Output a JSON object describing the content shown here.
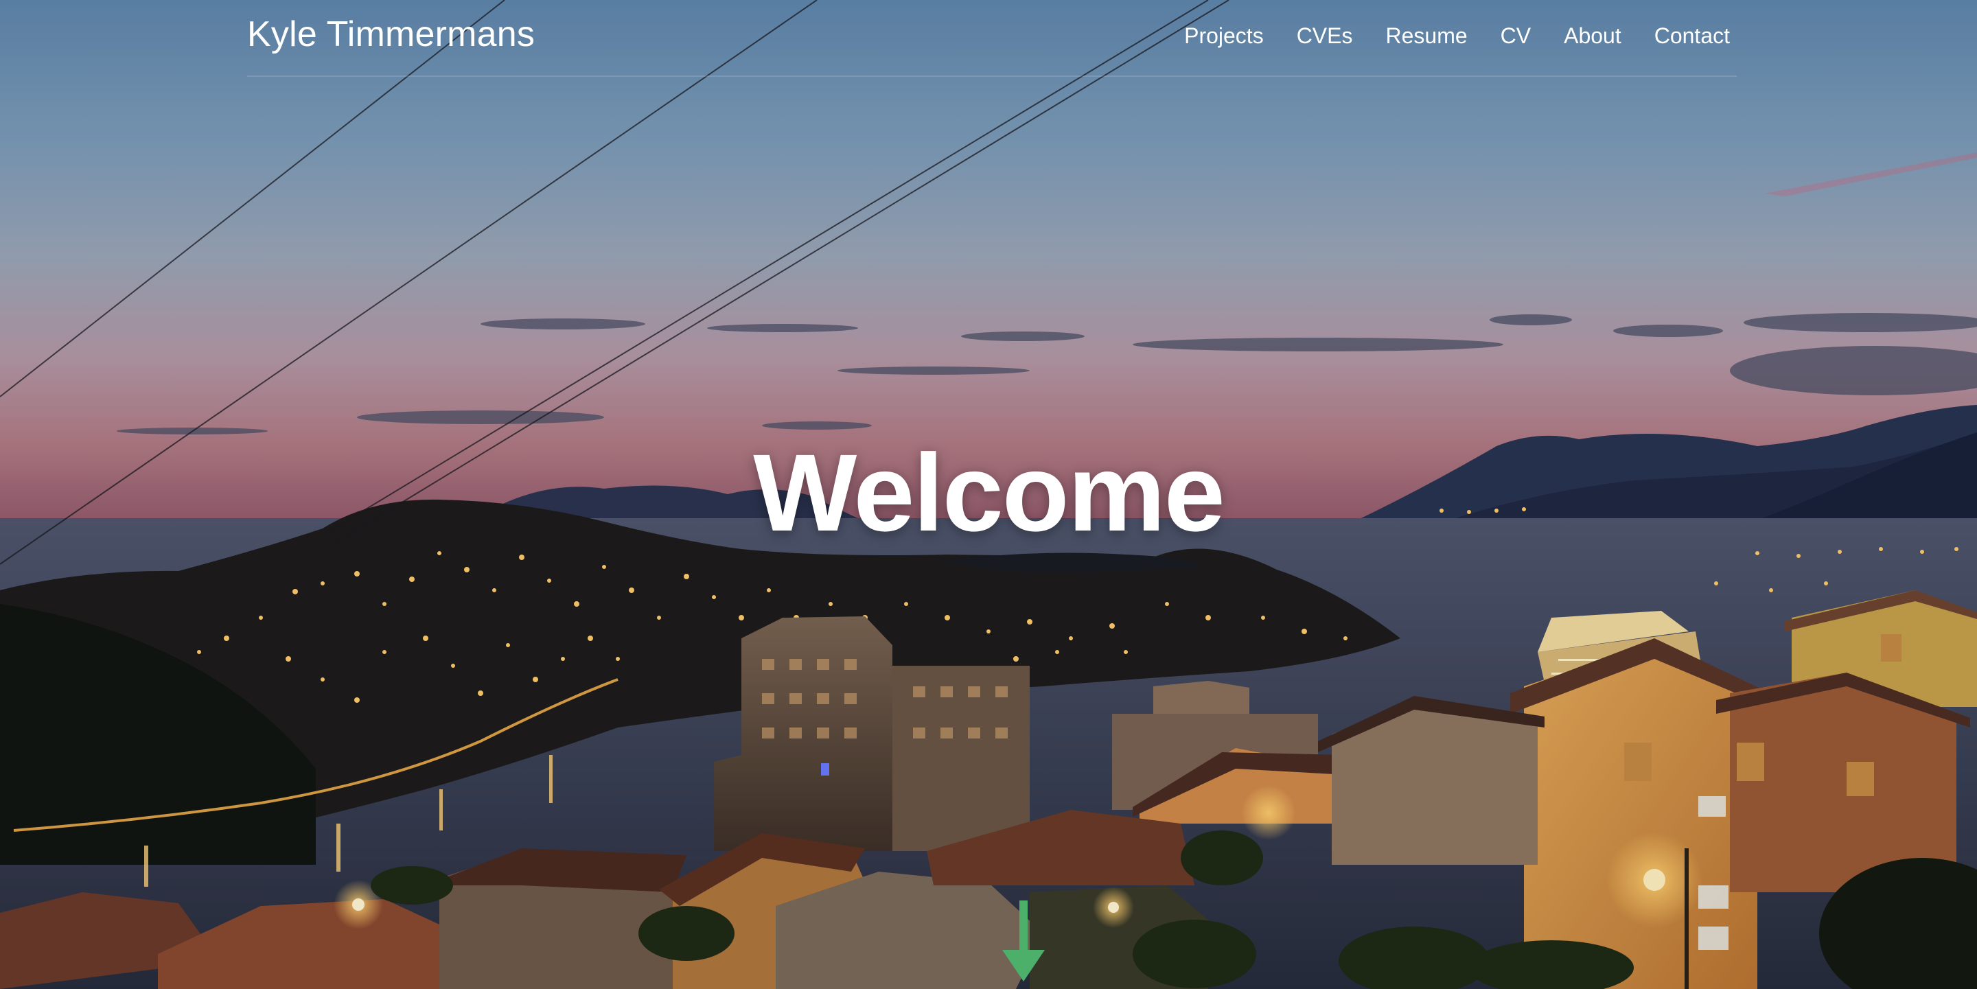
{
  "header": {
    "brand": "Kyle Timmermans",
    "nav": [
      {
        "label": "Projects"
      },
      {
        "label": "CVEs"
      },
      {
        "label": "Resume"
      },
      {
        "label": "CV"
      },
      {
        "label": "About"
      },
      {
        "label": "Contact"
      }
    ]
  },
  "hero": {
    "heading": "Welcome",
    "scroll_icon": "arrow-down-icon",
    "scroll_color": "#4caf6a"
  }
}
